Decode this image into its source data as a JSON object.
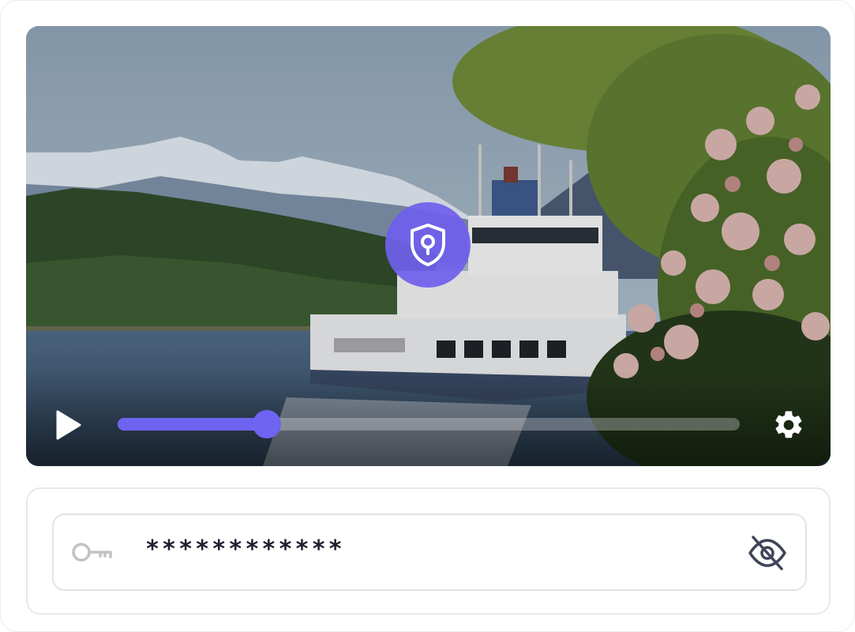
{
  "player": {
    "progress": 0.24,
    "accent_color": "#6f63f1",
    "icons": {
      "center": "shield-lock-icon",
      "play": "play-icon",
      "settings": "gear-icon"
    }
  },
  "password": {
    "value": "************",
    "icons": {
      "leading": "key-icon",
      "trailing": "eye-off-icon"
    }
  }
}
